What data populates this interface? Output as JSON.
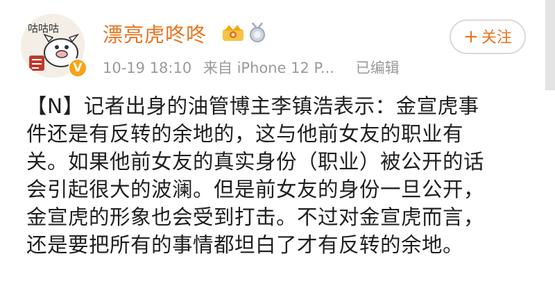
{
  "user": {
    "name": "漂亮虎咚咚",
    "avatar_text": "咕咕咕"
  },
  "meta": {
    "time": "10-19 18:10",
    "source": "来自 iPhone 12 P...",
    "edited": "已编辑"
  },
  "follow": {
    "plus": "+",
    "label": "关注"
  },
  "colors": {
    "accent": "#e8741e",
    "verified": "#f7a416",
    "meta": "#9a9a9a",
    "text": "#1f1f1f"
  },
  "icons": [
    "crown-badge-icon",
    "medal-badge-icon",
    "verified-icon"
  ],
  "content": {
    "lines": [
      "【N】记者出身的油管博主李镇浩表示：金宣虎事",
      "件还是有反转的余地的，这与他前女友的职业有",
      "关。如果他前女友的真实身份（职业）被公开的话",
      "会引起很大的波澜。但是前女友的身份一旦公开，",
      "金宣虎的形象也会受到打击。不过对金宣虎而言，",
      "还是要把所有的事情都坦白了才有反转的余地。"
    ]
  }
}
